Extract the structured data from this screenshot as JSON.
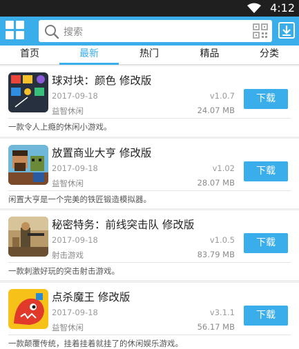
{
  "status_bar": {
    "time": "4:12",
    "wifi_icon": "wifi-icon"
  },
  "app_bar": {
    "menu_icon": "grid-menu-icon",
    "search_placeholder": "搜索",
    "search_icon": "search-icon",
    "qr_icon": "qr-code-icon",
    "download_icon": "download-icon",
    "accent_color": "#3aaeea"
  },
  "tabs": [
    "首页",
    "最新",
    "热门",
    "精品",
    "分类"
  ],
  "active_tab": "最新",
  "apps": [
    {
      "title": "球对块：颜色 修改版",
      "date": "2017-09-18",
      "category": "益智休闲",
      "version": "v1.0.7",
      "size": "24.07 MB",
      "button": "下载",
      "description": "一款令人上瘾的休闲小游戏。"
    },
    {
      "title": "放置商业大亨 修改版",
      "date": "2017-09-18",
      "category": "益智休闲",
      "version": "v1.02",
      "size": "28.07 MB",
      "button": "下载",
      "description": "闲置大亨是一个完美的铁匠锻造模拟器。"
    },
    {
      "title": "秘密特务：前线突击队 修改版",
      "date": "2017-09-18",
      "category": "射击游戏",
      "version": "v1.0.5",
      "size": "83.79 MB",
      "button": "下载",
      "description": "一款刺激好玩的突击射击游戏。"
    },
    {
      "title": "点杀魔王 修改版",
      "date": "2017-09-18",
      "category": "益智休闲",
      "version": "v3.1.1",
      "size": "56.17 MB",
      "button": "下载",
      "description": "一款颠覆传统，挂着挂着就挂了的休闲娱乐游戏。"
    }
  ]
}
